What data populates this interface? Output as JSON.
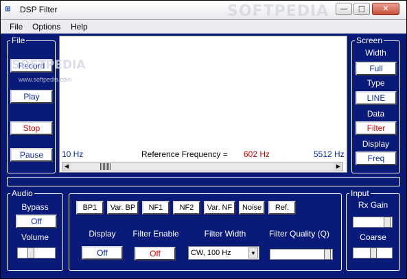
{
  "window": {
    "title": "DSP Filter",
    "watermark": "SOFTPEDIA",
    "controls": {
      "minimize": "—",
      "maximize": "□",
      "close": "✕"
    }
  },
  "menubar": {
    "items": [
      {
        "label": "File"
      },
      {
        "label": "Options"
      },
      {
        "label": "Help"
      }
    ]
  },
  "file_panel": {
    "title": "File",
    "record": "Record",
    "play": "Play",
    "stop": "Stop",
    "pause": "Pause"
  },
  "plot": {
    "watermark": "SOFTPEDIA",
    "watermark_url": "www.softpedia.com",
    "freq_low": "10 Hz",
    "ref_label": "Reference Frequency =",
    "ref_value": "602 Hz",
    "freq_high": "5512 Hz"
  },
  "screen_panel": {
    "title": "Screen",
    "width_label": "Width",
    "width_value": "Full",
    "type_label": "Type",
    "type_value": "LINE",
    "data_label": "Data",
    "data_value": "Filter",
    "display_label": "Display",
    "display_value": "Freq"
  },
  "audio_panel": {
    "title": "Audio",
    "bypass_label": "Bypass",
    "bypass_value": "Off",
    "volume_label": "Volume"
  },
  "filter_panel": {
    "filters": [
      "BP1",
      "Var. BP",
      "NF1",
      "NF2",
      "Var. NF",
      "Noise",
      "Ref."
    ],
    "display_label": "Display",
    "display_value": "Off",
    "enable_label": "Filter Enable",
    "enable_value": "Off",
    "width_label": "Filter Width",
    "width_value": "CW, 100 Hz",
    "quality_label": "Filter Quality (Q)"
  },
  "input_panel": {
    "title": "Input",
    "rx_gain_label": "Rx Gain",
    "coarse_label": "Coarse"
  },
  "colors": {
    "panel_bg": "#0a1a78",
    "accent_blue": "#0a2aa0",
    "accent_red": "#d00000"
  }
}
